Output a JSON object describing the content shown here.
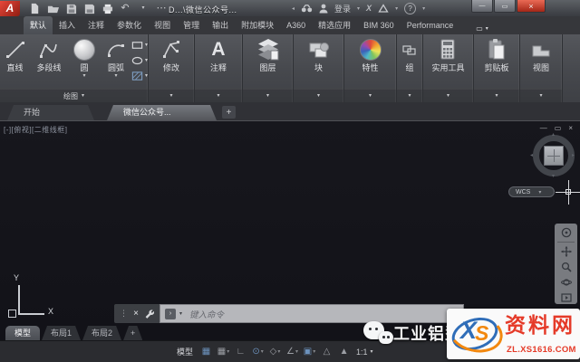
{
  "titlebar": {
    "title": "D...\\微信公众号...",
    "signin": "登录"
  },
  "icons": {
    "dropdown": "▾",
    "up": "▴",
    "left": "◂",
    "minimize": "—",
    "maximize": "▭",
    "close": "×",
    "undo": "↶",
    "more": "⋯",
    "a360": "X",
    "help": "?",
    "ribbon_toggle": "▭",
    "grip": "⋮",
    "grid": "▦",
    "snap": "▦",
    "ortho": "∟",
    "polar": "⊙",
    "iso": "◇",
    "track": "∠",
    "osnap": "▣",
    "annot": "△",
    "annot2": "▲",
    "chip": "›"
  },
  "colors": {
    "close_button": "#c0392b",
    "watermark_red": "#e53a28",
    "logo_blue": "#2f6db8",
    "logo_orange": "#f2880f"
  },
  "ribbon_tabs": [
    {
      "label": "默认"
    },
    {
      "label": "插入"
    },
    {
      "label": "注释"
    },
    {
      "label": "参数化"
    },
    {
      "label": "视图"
    },
    {
      "label": "管理"
    },
    {
      "label": "输出"
    },
    {
      "label": "附加模块"
    },
    {
      "label": "A360"
    },
    {
      "label": "精选应用"
    },
    {
      "label": "BIM 360"
    },
    {
      "label": "Performance"
    }
  ],
  "draw_panel": {
    "label": "绘图",
    "line": "直线",
    "polyline": "多段线",
    "circle": "圆",
    "arc": "圆弧"
  },
  "panels": {
    "modify": "修改",
    "annotate": "注释",
    "layers": "图层",
    "block": "块",
    "properties": "特性",
    "group": "组",
    "utilities": "实用工具",
    "clipboard": "剪贴板",
    "view": "视图"
  },
  "file_tabs": {
    "start": "开始",
    "drawing": "微信公众号...",
    "new": "+"
  },
  "drawing_area": {
    "viewport_label": "[-][俯视][二维线框]",
    "wcs": "WCS",
    "ucs_x": "X",
    "ucs_y": "Y"
  },
  "command": {
    "placeholder": "键入命令"
  },
  "layout_tabs": {
    "model": "模型",
    "layout1": "布局1",
    "layout2": "布局2",
    "new": "+"
  },
  "statusbar": {
    "model": "模型",
    "scale": "1:1"
  },
  "watermark": {
    "brand_text": "工业铝型",
    "logo_x": "X",
    "logo_s": "S",
    "logo_name": "资料网",
    "logo_url": "ZL.XS1616.COM"
  }
}
